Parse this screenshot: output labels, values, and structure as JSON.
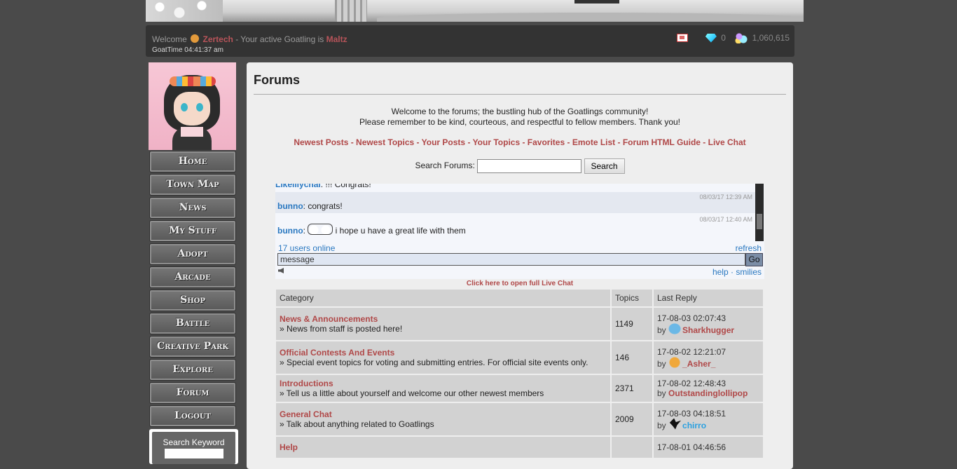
{
  "header": {
    "welcome_prefix": "Welcome",
    "username": "Zertech",
    "active_text": "- Your active Goatling is",
    "goatling": "Maltz",
    "goattime": "GoatTime 04:41:37 am",
    "gems": "0",
    "coins": "1,060,615"
  },
  "nav": {
    "items": [
      "Home",
      "Town Map",
      "News",
      "My Stuff",
      "Adopt",
      "Arcade",
      "Shop",
      "Battle",
      "Creative Park",
      "Explore",
      "Forum",
      "Logout"
    ]
  },
  "sidebar": {
    "search_label": "Search Keyword"
  },
  "main": {
    "title": "Forums",
    "intro_line1": "Welcome to the forums; the bustling hub of the Goatlings community!",
    "intro_line2": "Please remember to be kind, courteous, and respectful to fellow members. Thank you!",
    "links": [
      "Newest Posts",
      "Newest Topics",
      "Your Posts",
      "Your Topics",
      "Favorites",
      "Emote List",
      "Forum HTML Guide",
      "Live Chat"
    ],
    "search_label": "Search Forums:",
    "search_button": "Search"
  },
  "chat": {
    "messages": [
      {
        "user": "Likelilychai",
        "text": ": !!! Congrats!",
        "time": ""
      },
      {
        "user": "bunno",
        "text": ": congrats!",
        "time": "08/03/17 12:39 AM"
      },
      {
        "user": "bunno",
        "text": "i hope u have a great life with them",
        "time": "08/03/17 12:40 AM"
      }
    ],
    "online": "17 users online",
    "refresh": "refresh",
    "input_value": "message",
    "go": "Go",
    "help": "help",
    "sep": "·",
    "smilies": "smilies",
    "full_chat": "Click here to open full Live Chat"
  },
  "forums": {
    "headers": [
      "Category",
      "Topics",
      "Last Reply"
    ],
    "rows": [
      {
        "title": "News & Announcements",
        "desc": "» News from staff is posted here!",
        "topics": "1149",
        "date": "17-08-03 02:07:43",
        "by": "by",
        "user": "Sharkhugger",
        "icon": "bird-icon"
      },
      {
        "title": "Official Contests And Events",
        "desc": "» Special event topics for voting and submitting entries. For official site events only.",
        "topics": "146",
        "date": "17-08-02 12:21:07",
        "by": "by",
        "user": "_Asher_",
        "icon": "goat-icon"
      },
      {
        "title": "Introductions",
        "desc": "» Tell us a little about yourself and welcome our other newest members",
        "topics": "2371",
        "date": "17-08-02 12:48:43",
        "by": "by",
        "user": "Outstandinglollipop",
        "icon": ""
      },
      {
        "title": "General Chat",
        "desc": "» Talk about anything related to Goatlings",
        "topics": "2009",
        "date": "17-08-03 04:18:51",
        "by": "by",
        "user": "chirro",
        "icon": "crow-icon"
      },
      {
        "title": "Help",
        "desc": "",
        "topics": "",
        "date": "17-08-01 04:46:56",
        "by": "",
        "user": "",
        "icon": ""
      }
    ]
  }
}
